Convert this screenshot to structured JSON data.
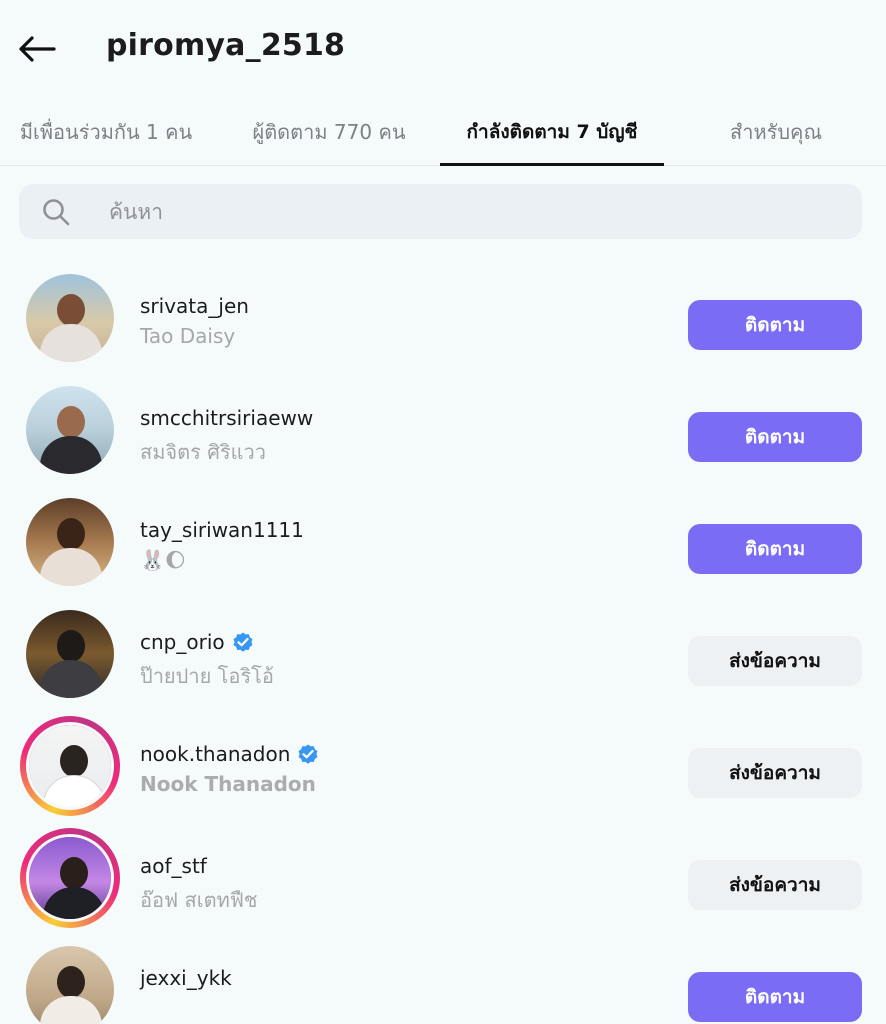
{
  "header": {
    "title": "piromya_2518",
    "back_icon": "arrow-left-icon"
  },
  "tabs": [
    {
      "label": "มีเพื่อนร่วมกัน 1 คน",
      "active": false
    },
    {
      "label": "ผู้ติดตาม 770 คน",
      "active": false
    },
    {
      "label": "กำลังติดตาม 7 บัญชี",
      "active": true
    },
    {
      "label": "สำหรับคุณ",
      "active": false
    }
  ],
  "search": {
    "placeholder": "ค้นหา",
    "value": "",
    "icon": "search-icon"
  },
  "accounts": [
    {
      "username": "srivata_jen",
      "display_name": "Tao Daisy",
      "verified": false,
      "story": false,
      "action": "ติดตาม",
      "action_type": "follow"
    },
    {
      "username": "smcchitrsiriaeww",
      "display_name": "สมจิตร ศิริแวว",
      "verified": false,
      "story": false,
      "action": "ติดตาม",
      "action_type": "follow"
    },
    {
      "username": "tay_siriwan1111",
      "display_name": "🐰🌔",
      "verified": false,
      "story": false,
      "action": "ติดตาม",
      "action_type": "follow"
    },
    {
      "username": "cnp_orio",
      "display_name": "ป๊ายปาย โอริโอ้",
      "verified": true,
      "story": false,
      "action": "ส่งข้อความ",
      "action_type": "message"
    },
    {
      "username": "nook.thanadon",
      "display_name": "Nook Thanadon",
      "verified": true,
      "story": true,
      "action": "ส่งข้อความ",
      "action_type": "message"
    },
    {
      "username": "aof_stf",
      "display_name": "อ๊อฟ สเตทฟืช",
      "verified": false,
      "story": true,
      "action": "ส่งข้อความ",
      "action_type": "message"
    },
    {
      "username": "jexxi_ykk",
      "display_name": "",
      "verified": false,
      "story": false,
      "action": "ติดตาม",
      "action_type": "follow"
    }
  ],
  "colors": {
    "accent": "#7a6cf5",
    "verified": "#3897f0",
    "background": "#f5fbfb"
  }
}
